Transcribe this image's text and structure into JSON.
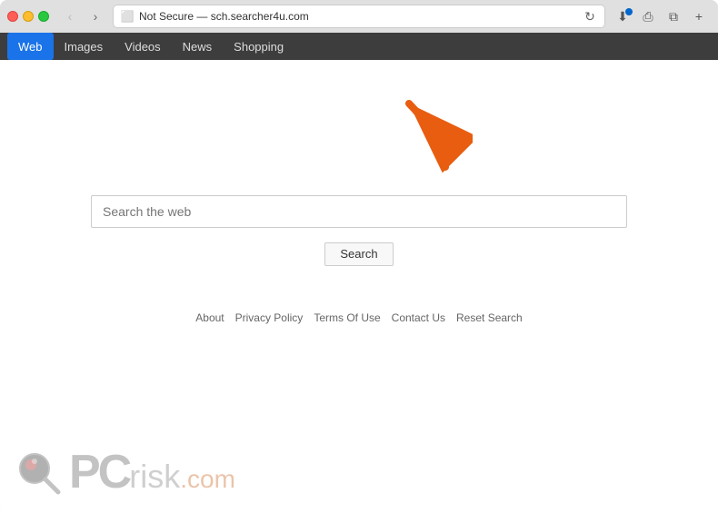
{
  "browser": {
    "title": "Not Secure — sch.searcher4u.com",
    "address_text": "Not Secure — sch.searcher4u.com"
  },
  "nav_tabs": [
    {
      "id": "web",
      "label": "Web",
      "active": true
    },
    {
      "id": "images",
      "label": "Images",
      "active": false
    },
    {
      "id": "videos",
      "label": "Videos",
      "active": false
    },
    {
      "id": "news",
      "label": "News",
      "active": false
    },
    {
      "id": "shopping",
      "label": "Shopping",
      "active": false
    }
  ],
  "search": {
    "placeholder": "Search the web",
    "button_label": "Search"
  },
  "footer_links": [
    {
      "id": "about",
      "label": "About"
    },
    {
      "id": "privacy",
      "label": "Privacy Policy"
    },
    {
      "id": "terms",
      "label": "Terms Of Use"
    },
    {
      "id": "contact",
      "label": "Contact Us"
    },
    {
      "id": "reset",
      "label": "Reset Search"
    }
  ],
  "watermark": {
    "pc_text": "PC",
    "risk_text": "risk",
    "com_text": ".com"
  },
  "icons": {
    "back": "‹",
    "forward": "›",
    "reload": "↻",
    "lock": "🔒",
    "download": "⬇",
    "share": "⎙",
    "tabs": "⧉",
    "add_tab": "+"
  }
}
